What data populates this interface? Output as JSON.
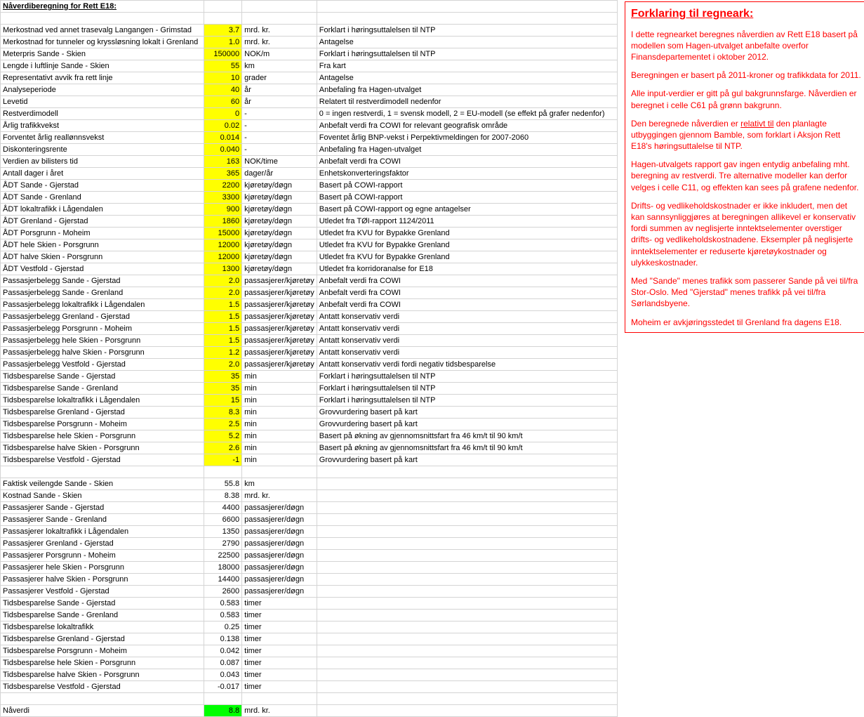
{
  "title": "Nåverdiberegning for Rett E18:",
  "inputs": [
    {
      "label": "Merkostnad ved annet trasevalg Langangen - Grimstad",
      "value": "3.7",
      "unit": "mrd. kr.",
      "note": "Forklart i høringsuttalelsen til NTP",
      "hl": true
    },
    {
      "label": "Merkostnad for tunneler og kryssløsning lokalt i Grenland",
      "value": "1.0",
      "unit": "mrd. kr.",
      "note": "Antagelse",
      "hl": true
    },
    {
      "label": "Meterpris Sande - Skien",
      "value": "150000",
      "unit": "NOK/m",
      "note": "Forklart i høringsuttalelsen til NTP",
      "hl": true
    },
    {
      "label": "Lengde i luftlinje Sande - Skien",
      "value": "55",
      "unit": "km",
      "note": "Fra kart",
      "hl": true
    },
    {
      "label": "Representativt avvik fra rett linje",
      "value": "10",
      "unit": "grader",
      "note": "Antagelse",
      "hl": true
    },
    {
      "label": "Analyseperiode",
      "value": "40",
      "unit": "år",
      "note": "Anbefaling fra Hagen-utvalget",
      "hl": true
    },
    {
      "label": "Levetid",
      "value": "60",
      "unit": "år",
      "note": "Relatert til restverdimodell nedenfor",
      "hl": true
    },
    {
      "label": "Restverdimodell",
      "value": "0",
      "unit": "-",
      "note": "0 = ingen restverdi, 1 = svensk modell, 2 = EU-modell (se effekt på grafer nedenfor)",
      "hl": true
    },
    {
      "label": "Årlig trafikkvekst",
      "value": "0.02",
      "unit": "-",
      "note": "Anbefalt verdi fra COWI for relevant geografisk område",
      "hl": true
    },
    {
      "label": "Forventet årlig reallønnsvekst",
      "value": "0.014",
      "unit": "-",
      "note": "Foventet årlig BNP-vekst i Perpektivmeldingen for 2007-2060",
      "hl": true
    },
    {
      "label": "Diskonteringsrente",
      "value": "0.040",
      "unit": "-",
      "note": "Anbefaling fra Hagen-utvalget",
      "hl": true
    },
    {
      "label": "Verdien av bilisters tid",
      "value": "163",
      "unit": "NOK/time",
      "note": "Anbefalt verdi fra COWI",
      "hl": true
    },
    {
      "label": "Antall dager i året",
      "value": "365",
      "unit": "dager/år",
      "note": "Enhetskonverteringsfaktor",
      "hl": true
    },
    {
      "label": "ÅDT Sande - Gjerstad",
      "value": "2200",
      "unit": "kjøretøy/døgn",
      "note": "Basert på COWI-rapport",
      "hl": true
    },
    {
      "label": "ÅDT Sande - Grenland",
      "value": "3300",
      "unit": "kjøretøy/døgn",
      "note": "Basert på COWI-rapport",
      "hl": true
    },
    {
      "label": "ÅDT lokaltrafikk i Lågendalen",
      "value": "900",
      "unit": "kjøretøy/døgn",
      "note": "Basert på COWI-rapport og egne antagelser",
      "hl": true
    },
    {
      "label": "ÅDT Grenland - Gjerstad",
      "value": "1860",
      "unit": "kjøretøy/døgn",
      "note": "Utledet fra TØI-rapport 1124/2011",
      "hl": true
    },
    {
      "label": "ÅDT Porsgrunn - Moheim",
      "value": "15000",
      "unit": "kjøretøy/døgn",
      "note": "Utledet fra KVU for Bypakke Grenland",
      "hl": true
    },
    {
      "label": "ÅDT hele Skien - Porsgrunn",
      "value": "12000",
      "unit": "kjøretøy/døgn",
      "note": "Utledet fra KVU for Bypakke Grenland",
      "hl": true
    },
    {
      "label": "ÅDT halve Skien - Porsgrunn",
      "value": "12000",
      "unit": "kjøretøy/døgn",
      "note": "Utledet fra KVU for Bypakke Grenland",
      "hl": true
    },
    {
      "label": "ÅDT Vestfold - Gjerstad",
      "value": "1300",
      "unit": "kjøretøy/døgn",
      "note": "Utledet fra korridoranalse for E18",
      "hl": true
    },
    {
      "label": "Passasjerbelegg Sande - Gjerstad",
      "value": "2.0",
      "unit": "passasjerer/kjøretøy",
      "note": "Anbefalt verdi fra COWI",
      "hl": true
    },
    {
      "label": "Passasjerbelegg Sande - Grenland",
      "value": "2.0",
      "unit": "passasjerer/kjøretøy",
      "note": "Anbefalt verdi fra COWI",
      "hl": true
    },
    {
      "label": "Passasjerbelegg lokaltrafikk i Lågendalen",
      "value": "1.5",
      "unit": "passasjerer/kjøretøy",
      "note": "Anbefalt verdi fra COWI",
      "hl": true
    },
    {
      "label": "Passasjerbelegg Grenland - Gjerstad",
      "value": "1.5",
      "unit": "passasjerer/kjøretøy",
      "note": "Antatt konservativ verdi",
      "hl": true
    },
    {
      "label": "Passasjerbelegg Porsgrunn - Moheim",
      "value": "1.5",
      "unit": "passasjerer/kjøretøy",
      "note": "Antatt konservativ verdi",
      "hl": true
    },
    {
      "label": "Passasjerbelegg hele Skien - Porsgrunn",
      "value": "1.5",
      "unit": "passasjerer/kjøretøy",
      "note": "Antatt konservativ verdi",
      "hl": true
    },
    {
      "label": "Passasjerbelegg halve Skien - Porsgrunn",
      "value": "1.2",
      "unit": "passasjerer/kjøretøy",
      "note": "Antatt konservativ verdi",
      "hl": true
    },
    {
      "label": "Passasjerbelegg Vestfold - Gjerstad",
      "value": "2.0",
      "unit": "passasjerer/kjøretøy",
      "note": "Antatt konservativ verdi fordi negativ tidsbesparelse",
      "hl": true
    },
    {
      "label": "Tidsbesparelse Sande - Gjerstad",
      "value": "35",
      "unit": "min",
      "note": "Forklart i høringsuttalelsen til NTP",
      "hl": true
    },
    {
      "label": "Tidsbesparelse Sande - Grenland",
      "value": "35",
      "unit": "min",
      "note": "Forklart i høringsuttalelsen til NTP",
      "hl": true
    },
    {
      "label": "Tidsbesparelse lokaltrafikk i Lågendalen",
      "value": "15",
      "unit": "min",
      "note": "Forklart i høringsuttalelsen til NTP",
      "hl": true
    },
    {
      "label": "Tidsbesparelse Grenland - Gjerstad",
      "value": "8.3",
      "unit": "min",
      "note": "Grovvurdering basert på kart",
      "hl": true
    },
    {
      "label": "Tidsbesparelse Porsgrunn - Moheim",
      "value": "2.5",
      "unit": "min",
      "note": "Grovvurdering basert på kart",
      "hl": true
    },
    {
      "label": "Tidsbesparelse hele Skien - Porsgrunn",
      "value": "5.2",
      "unit": "min",
      "note": "Basert på økning av gjennomsnittsfart fra 46 km/t til 90 km/t",
      "hl": true
    },
    {
      "label": "Tidsbesparelse halve Skien - Porsgrunn",
      "value": "2.6",
      "unit": "min",
      "note": "Basert på økning av gjennomsnittsfart fra 46 km/t til 90 km/t",
      "hl": true
    },
    {
      "label": "Tidsbesparelse Vestfold - Gjerstad",
      "value": "-1",
      "unit": "min",
      "note": "Grovvurdering basert på kart",
      "hl": true
    }
  ],
  "calcs": [
    {
      "label": "Faktisk veilengde Sande - Skien",
      "value": "55.8",
      "unit": "km"
    },
    {
      "label": "Kostnad Sande - Skien",
      "value": "8.38",
      "unit": "mrd. kr."
    },
    {
      "label": "Passasjerer Sande - Gjerstad",
      "value": "4400",
      "unit": "passasjerer/døgn"
    },
    {
      "label": "Passasjerer Sande - Grenland",
      "value": "6600",
      "unit": "passasjerer/døgn"
    },
    {
      "label": "Passasjerer lokaltrafikk i Lågendalen",
      "value": "1350",
      "unit": "passasjerer/døgn"
    },
    {
      "label": "Passasjerer Grenland - Gjerstad",
      "value": "2790",
      "unit": "passasjerer/døgn"
    },
    {
      "label": "Passasjerer Porsgrunn - Moheim",
      "value": "22500",
      "unit": "passasjerer/døgn"
    },
    {
      "label": "Passasjerer hele Skien - Porsgrunn",
      "value": "18000",
      "unit": "passasjerer/døgn"
    },
    {
      "label": "Passasjerer halve Skien - Porsgrunn",
      "value": "14400",
      "unit": "passasjerer/døgn"
    },
    {
      "label": "Passasjerer Vestfold - Gjerstad",
      "value": "2600",
      "unit": "passasjerer/døgn"
    },
    {
      "label": "Tidsbesparelse Sande - Gjerstad",
      "value": "0.583",
      "unit": "timer"
    },
    {
      "label": "Tidsbesparelse Sande - Grenland",
      "value": "0.583",
      "unit": "timer"
    },
    {
      "label": "Tidsbesparelse lokaltrafikk",
      "value": "0.25",
      "unit": "timer"
    },
    {
      "label": "Tidsbesparelse Grenland - Gjerstad",
      "value": "0.138",
      "unit": "timer"
    },
    {
      "label": "Tidsbesparelse Porsgrunn - Moheim",
      "value": "0.042",
      "unit": "timer"
    },
    {
      "label": "Tidsbesparelse hele Skien - Porsgrunn",
      "value": "0.087",
      "unit": "timer"
    },
    {
      "label": "Tidsbesparelse halve Skien - Porsgrunn",
      "value": "0.043",
      "unit": "timer"
    },
    {
      "label": "Tidsbesparelse Vestfold - Gjerstad",
      "value": "-0.017",
      "unit": "timer"
    }
  ],
  "result": {
    "label": "Nåverdi",
    "value": "8.8",
    "unit": "mrd. kr."
  },
  "explanation": {
    "heading": "Forklaring til regneark:",
    "p1": "I dette regnearket beregnes nåverdien av Rett E18 basert på modellen som Hagen-utvalget anbefalte overfor Finansdepartementet i oktober 2012.",
    "p2": "Beregningen er basert på 2011-kroner og trafikkdata for 2011.",
    "p3": "Alle input-verdier er gitt på gul bakgrunnsfarge. Nåverdien er beregnet i celle C61 på grønn bakgrunn.",
    "p4a": "Den beregnede nåverdien er ",
    "p4b": "relativt til",
    "p4c": " den planlagte utbyggingen gjennom Bamble, som forklart i Aksjon Rett E18's høringsuttalelse til NTP.",
    "p5": "Hagen-utvalgets rapport gav ingen entydig anbefaling mht. beregning av restverdi. Tre alternative modeller kan derfor velges i celle C11, og effekten kan sees på grafene nedenfor.",
    "p6": "Drifts- og vedlikeholdskostnader er ikke inkludert, men det kan sannsynliggjøres at beregningen allikevel er konservativ fordi summen av neglisjerte inntektselementer overstiger drifts- og vedlikeholdskostnadene. Eksempler på neglisjerte inntektselementer er reduserte kjøretøykostnader og ulykkeskostnader.",
    "p7": "Med \"Sande\" menes trafikk som passerer Sande på vei til/fra Stor-Oslo. Med \"Gjerstad\" menes trafikk på vei til/fra Sørlandsbyene.",
    "p8": "Moheim er avkjøringsstedet til Grenland fra dagens E18."
  }
}
